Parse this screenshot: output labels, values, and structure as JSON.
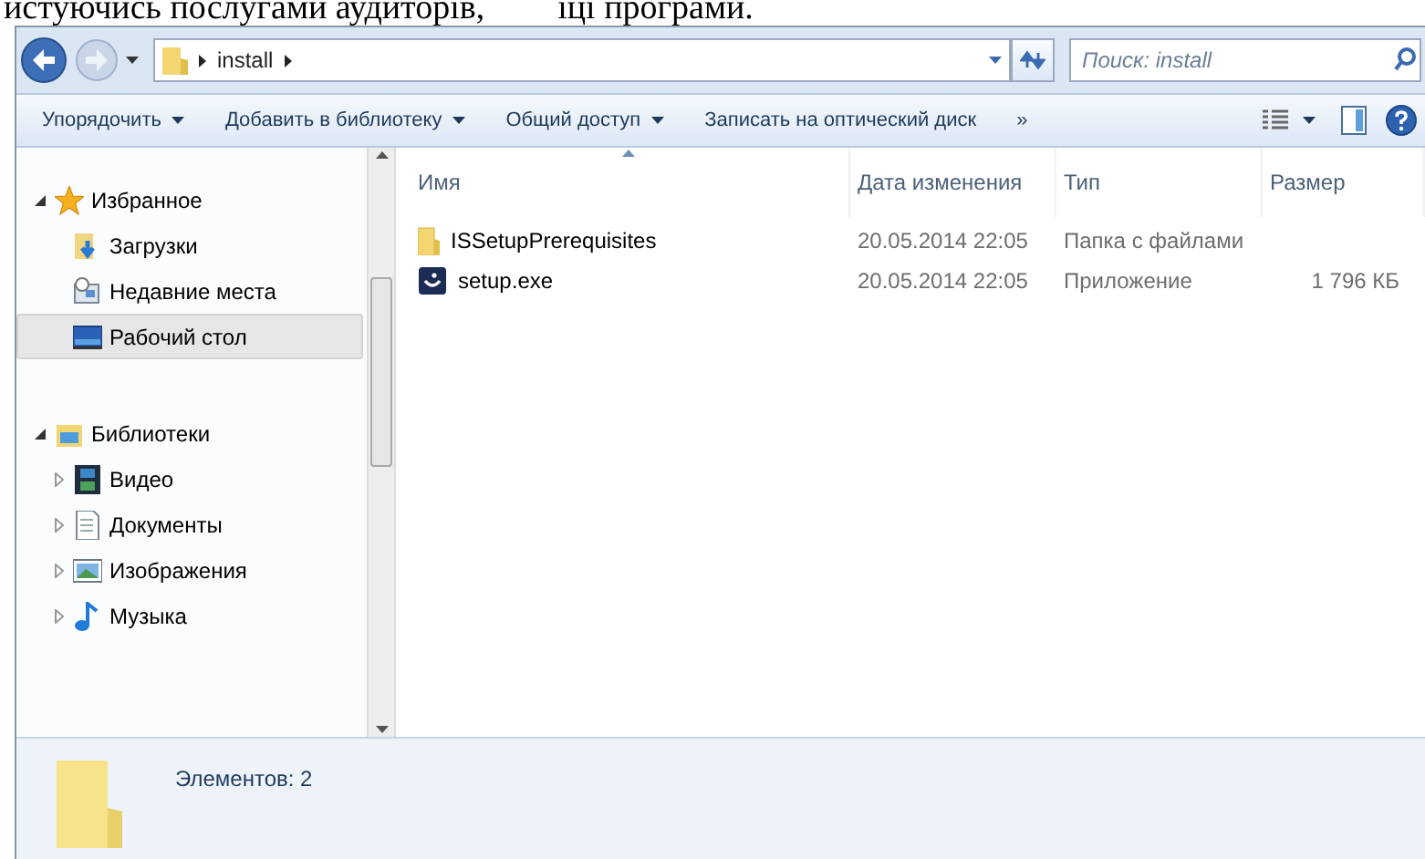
{
  "document_text": [
    "истуючись послугами аудиторів,",
    "іці програми."
  ],
  "address_bar": {
    "path": [
      "install"
    ]
  },
  "search": {
    "placeholder": "Поиск: install"
  },
  "toolbar": {
    "buttons": [
      {
        "label": "Упорядочить",
        "dropdown": true
      },
      {
        "label": "Добавить в библиотеку",
        "dropdown": true
      },
      {
        "label": "Общий доступ",
        "dropdown": true
      },
      {
        "label": "Записать на оптический диск",
        "dropdown": false
      },
      {
        "label": "»",
        "dropdown": false
      }
    ]
  },
  "navigation": [
    {
      "label": "Избранное",
      "kind": "star",
      "expanded": true,
      "selected": false,
      "children": [
        {
          "label": "Загрузки",
          "kind": "downloads",
          "selected": false
        },
        {
          "label": "Недавние места",
          "kind": "recent",
          "selected": false
        },
        {
          "label": "Рабочий стол",
          "kind": "desktop",
          "selected": true
        }
      ]
    },
    {
      "label": "Библиотеки",
      "kind": "library",
      "expanded": true,
      "selected": false,
      "children": [
        {
          "label": "Видео",
          "kind": "video",
          "expanded": false,
          "selected": false
        },
        {
          "label": "Документы",
          "kind": "documents",
          "expanded": false,
          "selected": false
        },
        {
          "label": "Изображения",
          "kind": "pictures",
          "expanded": false,
          "selected": false
        },
        {
          "label": "Музыка",
          "kind": "music",
          "expanded": false,
          "selected": false
        }
      ]
    }
  ],
  "file_list": {
    "columns": [
      {
        "label": "Имя",
        "sorted": true
      },
      {
        "label": "Дата изменения",
        "sorted": false
      },
      {
        "label": "Тип",
        "sorted": false
      },
      {
        "label": "Размер",
        "sorted": false
      }
    ],
    "rows": [
      {
        "kind": "folder",
        "name": "ISSetupPrerequisites",
        "date": "20.05.2014 22:05",
        "type": "Папка с файлами"
      },
      {
        "kind": "app",
        "name": "setup.exe",
        "date": "20.05.2014 22:05",
        "type": "Приложение",
        "size": "1 796 КБ"
      }
    ]
  },
  "status_bar": {
    "text": "Элементов: 2"
  }
}
